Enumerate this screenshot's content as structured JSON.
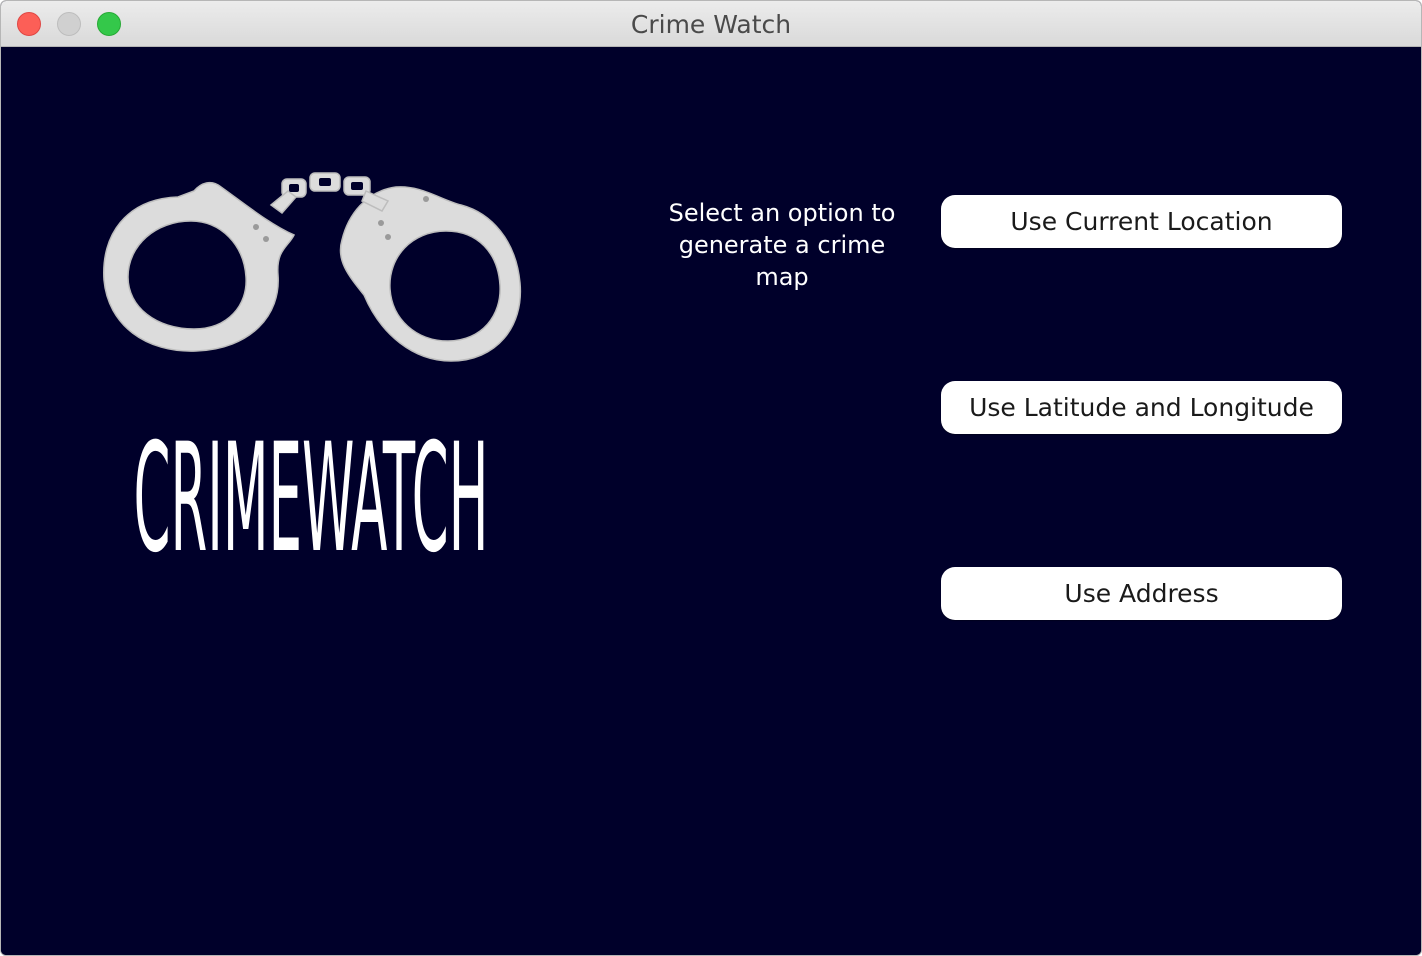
{
  "window": {
    "title": "Crime Watch"
  },
  "logo": {
    "wordmark": "CRIMEWATCH",
    "color": "#ffffff",
    "cuff_color": "#dcdcdc"
  },
  "main": {
    "prompt": "Select an option to generate a crime map",
    "buttons": [
      {
        "label": "Use Current Location"
      },
      {
        "label": "Use Latitude and Longitude"
      },
      {
        "label": "Use Address"
      }
    ]
  },
  "colors": {
    "background": "#00002a",
    "button_background": "#ffffff",
    "close": "#fc5f57",
    "zoom": "#34c84a"
  }
}
